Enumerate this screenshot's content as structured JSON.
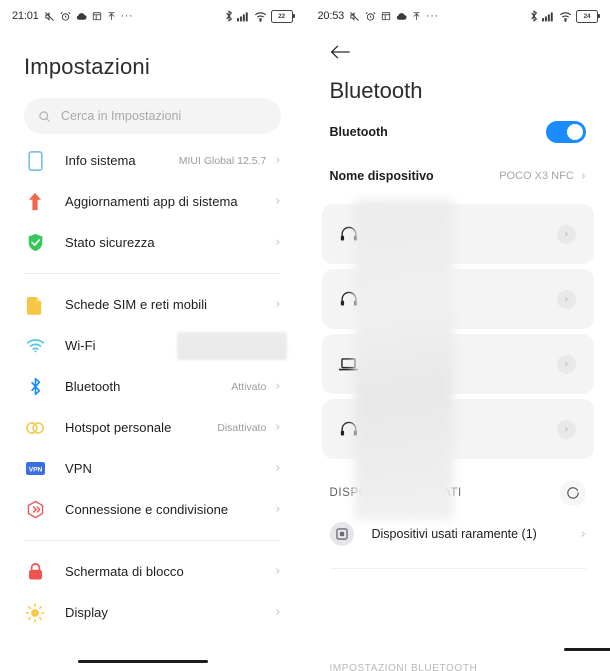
{
  "left": {
    "status_bar": {
      "time": "21:01",
      "left_icons": [
        "silent-mode-icon",
        "alarm-icon",
        "cloud-icon",
        "calendar-icon",
        "upload-icon",
        "more-icon"
      ],
      "right_icons": [
        "bluetooth-icon",
        "signal-icon",
        "wifi-icon",
        "battery-icon"
      ],
      "battery_level": "22"
    },
    "title": "Impostazioni",
    "search": {
      "placeholder": "Cerca in Impostazioni"
    },
    "groups": [
      {
        "items": [
          {
            "label": "Info sistema",
            "value": "MIUI Global 12.5.7",
            "icon": "phone-icon",
            "redacted": false
          },
          {
            "label": "Aggiornamenti app di sistema",
            "value": "",
            "icon": "update-arrow-icon",
            "redacted": false
          },
          {
            "label": "Stato sicurezza",
            "value": "",
            "icon": "shield-check-icon",
            "redacted": false
          }
        ]
      },
      {
        "items": [
          {
            "label": "Schede SIM e reti mobili",
            "value": "",
            "icon": "sim-card-icon",
            "redacted": false
          },
          {
            "label": "Wi-Fi",
            "value": "",
            "icon": "wifi-icon",
            "redacted": true
          },
          {
            "label": "Bluetooth",
            "value": "Attivato",
            "icon": "bluetooth-icon",
            "redacted": false
          },
          {
            "label": "Hotspot personale",
            "value": "Disattivato",
            "icon": "hotspot-icon",
            "redacted": false
          },
          {
            "label": "VPN",
            "value": "",
            "icon": "vpn-icon",
            "redacted": false
          },
          {
            "label": "Connessione e condivisione",
            "value": "",
            "icon": "share-icon",
            "redacted": false
          }
        ]
      },
      {
        "items": [
          {
            "label": "Schermata di blocco",
            "value": "",
            "icon": "lock-icon",
            "redacted": false
          },
          {
            "label": "Display",
            "value": "",
            "icon": "brightness-icon",
            "redacted": false
          }
        ]
      }
    ]
  },
  "right": {
    "status_bar": {
      "time": "20:53",
      "battery_level": "24"
    },
    "back_icon": "back-arrow-icon",
    "title": "Bluetooth",
    "toggle_row": {
      "label": "Bluetooth",
      "state": "on"
    },
    "device_name_row": {
      "label": "Nome dispositivo",
      "value": "POCO X3 NFC"
    },
    "paired_devices": [
      {
        "name": "",
        "icon": "headphones-icon",
        "redacted": true
      },
      {
        "name": "",
        "icon": "headphones-icon",
        "redacted": true
      },
      {
        "name": "",
        "icon": "laptop-icon",
        "redacted": true
      },
      {
        "name": "",
        "icon": "headphones-icon",
        "redacted": true
      }
    ],
    "discovered": {
      "header": "DISPOSITIVI RILEVATI",
      "refresh_icon": "refresh-spinner-icon",
      "row": {
        "label": "Dispositivi usati raramente (1)",
        "icon": "device-square-icon"
      }
    },
    "footer": "IMPOSTAZIONI BLUETOOTH"
  },
  "colors": {
    "toggle_on": "#1a8cff",
    "phone_icon": "#6ab7e8",
    "update_icon": "#f4664a",
    "shield_icon": "#34c759",
    "sim_icon": "#f5c33b",
    "wifi_icon": "#4ec8e0",
    "bluetooth_icon": "#1a8cff",
    "hotspot_icon": "#f0cf5e",
    "vpn_icon": "#3b6fe0",
    "share_icon": "#e8585f",
    "lock_icon": "#ef5350",
    "brightness_icon": "#f7c948"
  }
}
